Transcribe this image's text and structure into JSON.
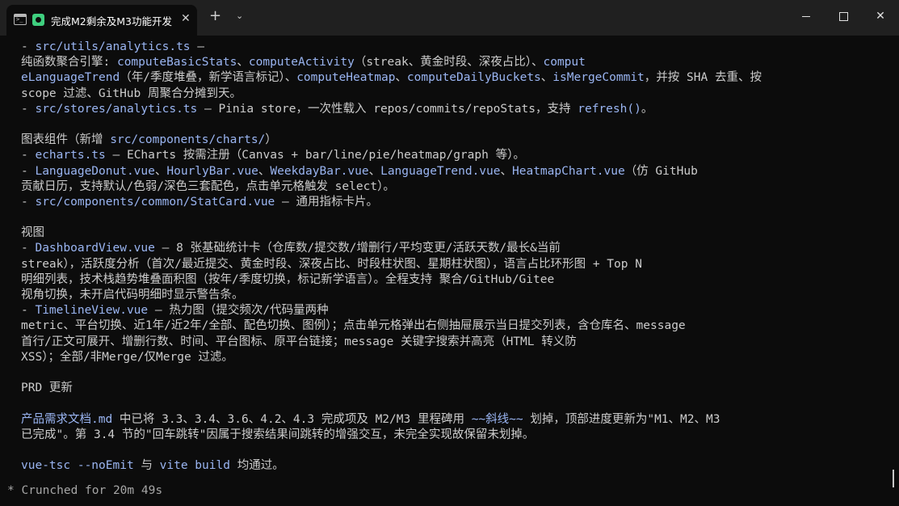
{
  "window": {
    "tab_title": "完成M2剩余及M3功能开发",
    "tab_close": "✕",
    "new_tab": "+",
    "dropdown": "⌄",
    "close_glyph": "✕"
  },
  "terminal": {
    "lines": [
      [
        [
          "n",
          "- "
        ],
        [
          "b",
          "src/utils/analytics.ts"
        ],
        [
          "n",
          " –"
        ]
      ],
      [
        [
          "n",
          "纯函数聚合引擎: "
        ],
        [
          "b",
          "computeBasicStats"
        ],
        [
          "n",
          "、"
        ],
        [
          "b",
          "computeActivity"
        ],
        [
          "n",
          "（streak、黄金时段、深夜占比）、"
        ],
        [
          "b",
          "comput"
        ]
      ],
      [
        [
          "b",
          "eLanguageTrend"
        ],
        [
          "n",
          "（年/季度堆叠，新学语言标记）、"
        ],
        [
          "b",
          "computeHeatmap"
        ],
        [
          "n",
          "、"
        ],
        [
          "b",
          "computeDailyBuckets"
        ],
        [
          "n",
          "、"
        ],
        [
          "b",
          "isMergeCommit"
        ],
        [
          "n",
          "，并按 SHA 去重、按"
        ]
      ],
      [
        [
          "n",
          "scope 过滤、GitHub 周聚合分摊到天。"
        ]
      ],
      [
        [
          "n",
          "- "
        ],
        [
          "b",
          "src/stores/analytics.ts"
        ],
        [
          "n",
          " – Pinia store，一次性载入 repos/commits/repoStats，支持 "
        ],
        [
          "b",
          "refresh()"
        ],
        [
          "n",
          "。"
        ]
      ],
      [
        [
          "n",
          ""
        ]
      ],
      [
        [
          "n",
          "图表组件（新增 "
        ],
        [
          "b",
          "src/components/charts/"
        ],
        [
          "n",
          "）"
        ]
      ],
      [
        [
          "n",
          "- "
        ],
        [
          "b",
          "echarts.ts"
        ],
        [
          "n",
          " – ECharts 按需注册（Canvas + bar/line/pie/heatmap/graph 等）。"
        ]
      ],
      [
        [
          "n",
          "- "
        ],
        [
          "b",
          "LanguageDonut.vue"
        ],
        [
          "n",
          "、"
        ],
        [
          "b",
          "HourlyBar.vue"
        ],
        [
          "n",
          "、"
        ],
        [
          "b",
          "WeekdayBar.vue"
        ],
        [
          "n",
          "、"
        ],
        [
          "b",
          "LanguageTrend.vue"
        ],
        [
          "n",
          "、"
        ],
        [
          "b",
          "HeatmapChart.vue"
        ],
        [
          "n",
          "（仿 GitHub"
        ]
      ],
      [
        [
          "n",
          "贡献日历，支持默认/色弱/深色三套配色，点击单元格触发 select）。"
        ]
      ],
      [
        [
          "n",
          "- "
        ],
        [
          "b",
          "src/components/common/StatCard.vue"
        ],
        [
          "n",
          " – 通用指标卡片。"
        ]
      ],
      [
        [
          "n",
          ""
        ]
      ],
      [
        [
          "n",
          "视图"
        ]
      ],
      [
        [
          "n",
          "- "
        ],
        [
          "b",
          "DashboardView.vue"
        ],
        [
          "n",
          " – 8 张基础统计卡（仓库数/提交数/增删行/平均变更/活跃天数/最长&当前"
        ]
      ],
      [
        [
          "n",
          "streak），活跃度分析（首次/最近提交、黄金时段、深夜占比、时段柱状图、星期柱状图），语言占比环形图 + Top N"
        ]
      ],
      [
        [
          "n",
          "明细列表，技术栈趋势堆叠面积图（按年/季度切换，标记新学语言）。全程支持 聚合/GitHub/Gitee"
        ]
      ],
      [
        [
          "n",
          "视角切换，未开启代码明细时显示警告条。"
        ]
      ],
      [
        [
          "n",
          "- "
        ],
        [
          "b",
          "TimelineView.vue"
        ],
        [
          "n",
          " – 热力图（提交频次/代码量两种"
        ]
      ],
      [
        [
          "n",
          "metric、平台切换、近1年/近2年/全部、配色切换、图例）；点击单元格弹出右侧抽屉展示当日提交列表，含仓库名、message"
        ]
      ],
      [
        [
          "n",
          "首行/正文可展开、增删行数、时间、平台图标、原平台链接；message 关键字搜索并高亮（HTML 转义防"
        ]
      ],
      [
        [
          "n",
          "XSS）；全部/非Merge/仅Merge 过滤。"
        ]
      ],
      [
        [
          "n",
          ""
        ]
      ],
      [
        [
          "n",
          "PRD 更新"
        ]
      ],
      [
        [
          "n",
          ""
        ]
      ],
      [
        [
          "b",
          "产品需求文档.md"
        ],
        [
          "n",
          " 中已将 3.3、3.4、3.6、4.2、4.3 完成项及 M2/M3 里程碑用 "
        ],
        [
          "b",
          "~~斜线~~"
        ],
        [
          "n",
          " 划掉，顶部进度更新为\"M1、M2、M3"
        ]
      ],
      [
        [
          "n",
          "已完成\"。第 3.4 节的\"回车跳转\"因属于搜索结果间跳转的增强交互，未完全实现故保留未划掉。"
        ]
      ],
      [
        [
          "n",
          ""
        ]
      ],
      [
        [
          "b",
          "vue-tsc --noEmit"
        ],
        [
          "n",
          " 与 "
        ],
        [
          "b",
          "vite build"
        ],
        [
          "n",
          " 均通过。"
        ]
      ]
    ],
    "status": "* Crunched for 20m 49s"
  }
}
